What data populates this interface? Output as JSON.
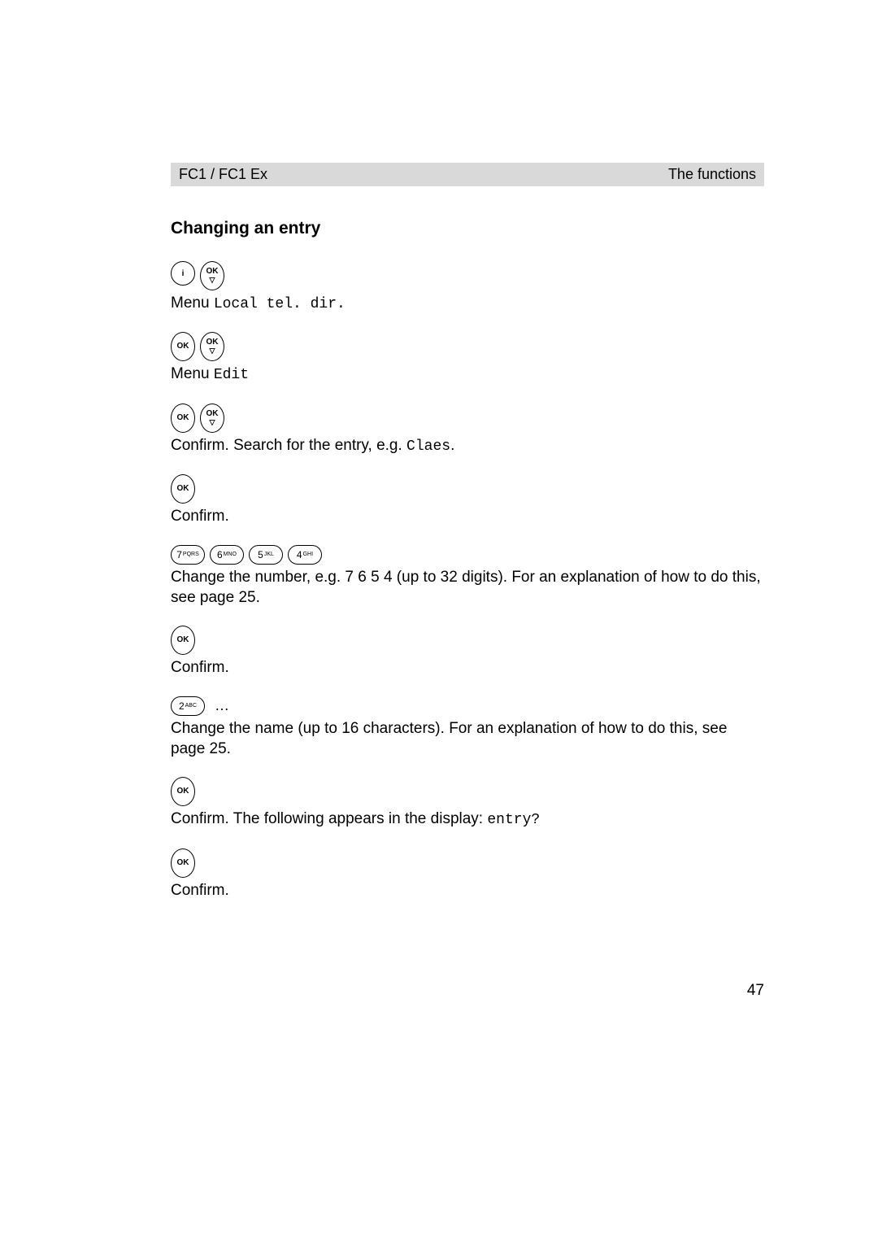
{
  "header": {
    "left": "FC1 / FC1 Ex",
    "right": "The functions"
  },
  "section_title": "Changing an entry",
  "buttons": {
    "i": "i",
    "ok": "OK",
    "tri": "▽",
    "key7": "7",
    "key7_letters": "PQRS",
    "key6": "6",
    "key6_letters": "MNO",
    "key5": "5",
    "key5_letters": "JKL",
    "key4": "4",
    "key4_letters": "GHI",
    "key2": "2",
    "key2_letters": "ABC"
  },
  "steps": {
    "s1_prefix": "Menu ",
    "s1_mono": "Local tel. dir.",
    "s2_prefix": "Menu ",
    "s2_mono": "Edit",
    "s3_prefix": "Confirm. Search for the entry, e.g. ",
    "s3_mono": "Claes",
    "s3_suffix": ".",
    "s4": "Confirm.",
    "s5": "Change the number, e.g. 7 6 5 4 (up to 32 digits). For an explanation of how to do this, see page 25.",
    "s6": "Confirm.",
    "s7_dots": "…",
    "s7": "Change the name (up to 16 characters). For an explanation of how to do this, see page 25.",
    "s8_prefix": "Confirm. The following appears in the display: ",
    "s8_mono": "entry?",
    "s9": "Confirm."
  },
  "page_number": "47"
}
